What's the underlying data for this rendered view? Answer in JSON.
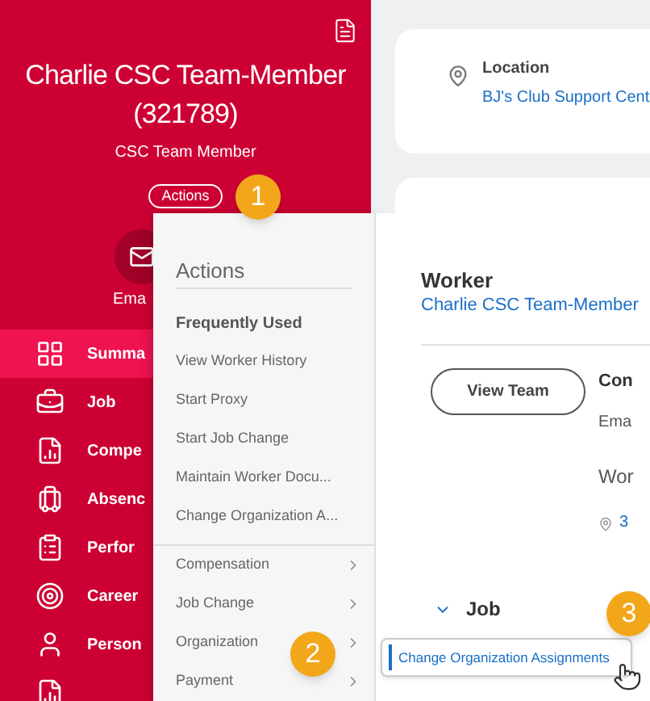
{
  "header": {
    "name": "Charlie CSC Team-Member (321789)",
    "title": "CSC Team Member",
    "actions_button": "Actions",
    "email_label": "Ema"
  },
  "sidebar": {
    "items": [
      {
        "label": "Summa",
        "kind": "grid",
        "selected": true
      },
      {
        "label": "Job",
        "kind": "briefcase",
        "selected": false
      },
      {
        "label": "Compe",
        "kind": "chart",
        "selected": false
      },
      {
        "label": "Absenc",
        "kind": "luggage",
        "selected": false
      },
      {
        "label": "Perfor",
        "kind": "clipboard",
        "selected": false
      },
      {
        "label": "Career",
        "kind": "target",
        "selected": false
      },
      {
        "label": "Person",
        "kind": "person",
        "selected": false
      },
      {
        "kind": "chart",
        "selected": false
      }
    ]
  },
  "location_card": {
    "label": "Location",
    "value": "BJ's Club Support Cent"
  },
  "actions_menu": {
    "title": "Actions",
    "section": "Frequently Used",
    "items": [
      "View Worker History",
      "Start Proxy",
      "Start Job Change",
      "Maintain Worker Docu...",
      "Change Organization A..."
    ],
    "submenus": [
      "Compensation",
      "Job Change",
      "Organization",
      "Payment"
    ]
  },
  "worker_panel": {
    "label": "Worker",
    "name_link": "Charlie CSC Team-Member",
    "button": "View Team",
    "contact_heading": "Con",
    "email_label": "Ema",
    "work_label": "Wor",
    "address": "3",
    "section": "Job",
    "expanded": true
  },
  "tooltip": "Change Organization Assignments",
  "step_badges": [
    "1",
    "2",
    "3"
  ]
}
